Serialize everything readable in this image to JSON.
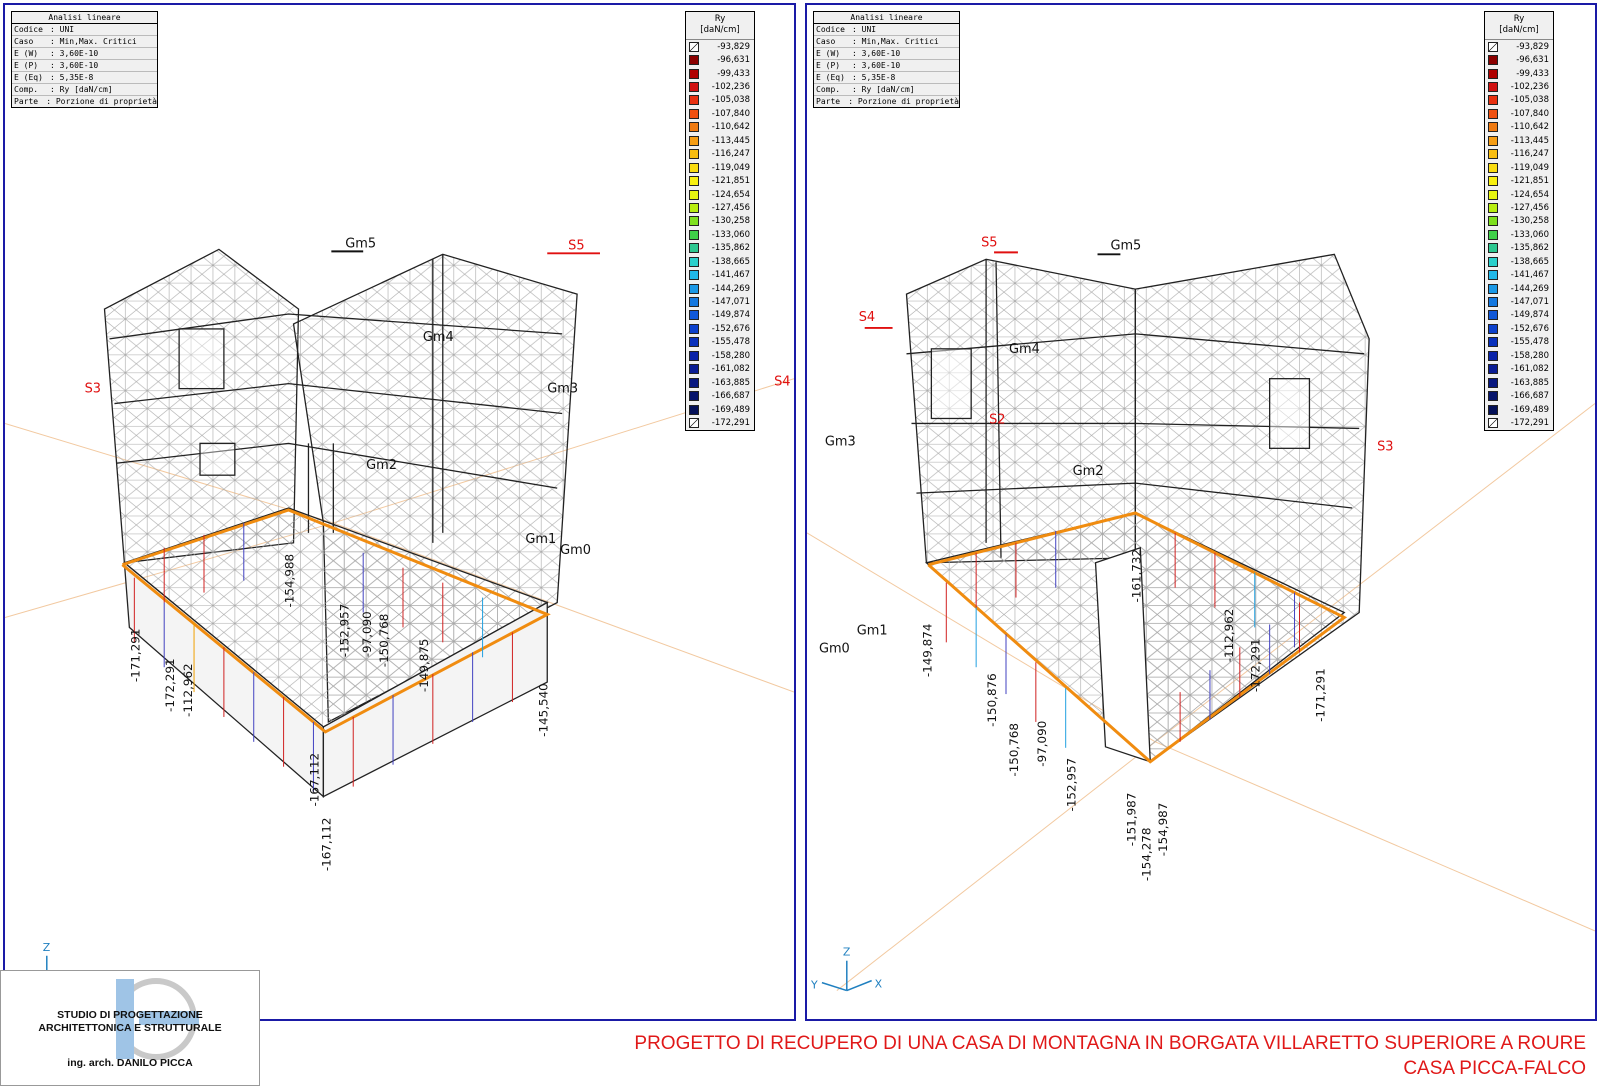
{
  "info_box": {
    "title": "Analisi lineare",
    "rows": [
      {
        "key": "Codice",
        "value": ": UNI"
      },
      {
        "key": "Caso",
        "value": ": Min,Max. Critici"
      },
      {
        "key": "E (W)",
        "value": ": 3,60E-10"
      },
      {
        "key": "E (P)",
        "value": ": 3,60E-10"
      },
      {
        "key": "E (Eq)",
        "value": ": 5,35E-8"
      },
      {
        "key": "Comp.",
        "value": ": Ry [daN/cm]"
      },
      {
        "key": "Parte",
        "value": ": Porzione di proprietà"
      }
    ]
  },
  "legend": {
    "title": "Ry",
    "unit": "[daN/cm]",
    "values": [
      "-93,829",
      "-96,631",
      "-99,433",
      "-102,236",
      "-105,038",
      "-107,840",
      "-110,642",
      "-113,445",
      "-116,247",
      "-119,049",
      "-121,851",
      "-124,654",
      "-127,456",
      "-130,258",
      "-133,060",
      "-135,862",
      "-138,665",
      "-141,467",
      "-144,269",
      "-147,071",
      "-149,874",
      "-152,676",
      "-155,478",
      "-158,280",
      "-161,082",
      "-163,885",
      "-166,687",
      "-169,489",
      "-172,291"
    ],
    "colors": [
      "#ffffff",
      "#8b0000",
      "#b00000",
      "#d01010",
      "#e83010",
      "#f05010",
      "#f07a10",
      "#f59d14",
      "#f8bd10",
      "#f9dc10",
      "#f8f010",
      "#e6f510",
      "#b8ee10",
      "#7ee01e",
      "#3fd048",
      "#2cc890",
      "#2ad0cc",
      "#20b8e8",
      "#1a98e6",
      "#1478e0",
      "#1058d8",
      "#0c40cc",
      "#0830bc",
      "#0a22a8",
      "#0a1c94",
      "#081880",
      "#06146c",
      "#041058",
      "#ffffff"
    ]
  },
  "left_view": {
    "labels": [
      {
        "name": "Gm5",
        "kind": "member",
        "text": "Gm5"
      },
      {
        "name": "S5",
        "kind": "section",
        "text": "S5"
      },
      {
        "name": "Gm4",
        "kind": "member",
        "text": "Gm4"
      },
      {
        "name": "S3",
        "kind": "section",
        "text": "S3"
      },
      {
        "name": "Gm3",
        "kind": "member",
        "text": "Gm3"
      },
      {
        "name": "S4",
        "kind": "section",
        "text": "S4"
      },
      {
        "name": "Gm2",
        "kind": "member",
        "text": "Gm2"
      },
      {
        "name": "Gm1",
        "kind": "member",
        "text": "Gm1"
      },
      {
        "name": "Gm0",
        "kind": "member",
        "text": "Gm0"
      }
    ],
    "values": [
      "-171,291",
      "-172,291",
      "-112,962",
      "-154,988",
      "-152,957",
      "-97,090",
      "-150,768",
      "-149,875",
      "-145,540",
      "-167,112",
      "-167,112"
    ],
    "axes": [
      "Z"
    ]
  },
  "right_view": {
    "labels": [
      {
        "name": "S5",
        "kind": "section",
        "text": "S5"
      },
      {
        "name": "Gm5",
        "kind": "member",
        "text": "Gm5"
      },
      {
        "name": "S4",
        "kind": "section",
        "text": "S4"
      },
      {
        "name": "Gm4",
        "kind": "member",
        "text": "Gm4"
      },
      {
        "name": "S2",
        "kind": "section",
        "text": "S2"
      },
      {
        "name": "Gm3",
        "kind": "member",
        "text": "Gm3"
      },
      {
        "name": "S3",
        "kind": "section",
        "text": "S3"
      },
      {
        "name": "Gm2",
        "kind": "member",
        "text": "Gm2"
      },
      {
        "name": "Gm1",
        "kind": "member",
        "text": "Gm1"
      },
      {
        "name": "Gm0",
        "kind": "member",
        "text": "Gm0"
      }
    ],
    "values": [
      "-149,874",
      "-150,876",
      "-150,768",
      "-97,090",
      "-152,957",
      "-151,987",
      "-154,278",
      "-154,987",
      "-161,732",
      "-112,962",
      "-172,291",
      "-171,291"
    ],
    "axes": [
      "Z",
      "Y",
      "X"
    ]
  },
  "logo": {
    "line1": "STUDIO DI PROGETTAZIONE",
    "line2": "ARCHITETTONICA E STRUTTURALE",
    "line3": "ing. arch. DANILO PICCA"
  },
  "footer": {
    "line1": "PROGETTO DI RECUPERO DI UNA CASA DI MONTAGNA IN BORGATA VILLARETTO SUPERIORE A ROURE",
    "line2": "CASA PICCA-FALCO",
    "color": "#e01818"
  }
}
